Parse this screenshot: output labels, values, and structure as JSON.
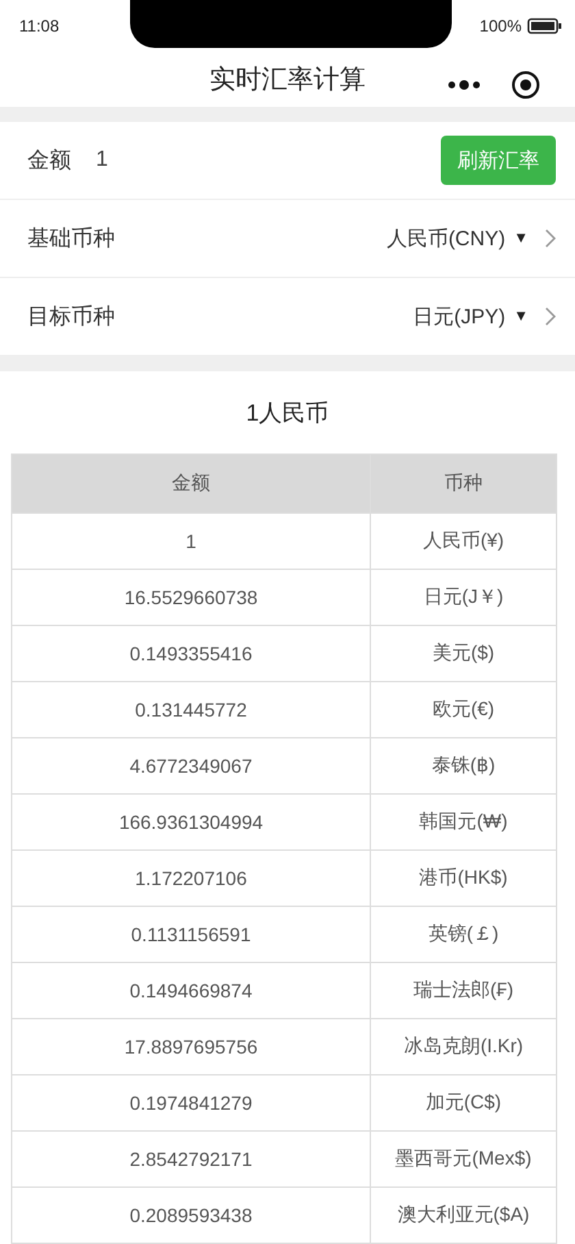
{
  "status_bar": {
    "time": "11:08",
    "battery_text": "100%"
  },
  "nav": {
    "title": "实时汇率计算"
  },
  "form": {
    "amount_label": "金额",
    "amount_value": "1",
    "refresh_button": "刷新汇率",
    "pickers": [
      {
        "label": "基础币种",
        "value": "人民币(CNY)",
        "caret": "▼"
      },
      {
        "label": "目标币种",
        "value": "日元(JPY)",
        "caret": "▼"
      }
    ]
  },
  "result": {
    "title": "1人民币",
    "columns": [
      "金额",
      "币种"
    ],
    "rows": [
      [
        "1",
        "人民币(¥)"
      ],
      [
        "16.5529660738",
        "日元(J￥)"
      ],
      [
        "0.1493355416",
        "美元($)"
      ],
      [
        "0.131445772",
        "欧元(€)"
      ],
      [
        "4.6772349067",
        "泰铢(฿)"
      ],
      [
        "166.9361304994",
        "韩国元(₩)"
      ],
      [
        "1.172207106",
        "港币(HK$)"
      ],
      [
        "0.1131156591",
        "英镑(￡)"
      ],
      [
        "0.1494669874",
        "瑞士法郎(₣)"
      ],
      [
        "17.8897695756",
        "冰岛克朗(I.Kr)"
      ],
      [
        "0.1974841279",
        "加元(C$)"
      ],
      [
        "2.8542792171",
        "墨西哥元(Mex$)"
      ],
      [
        "0.2089593438",
        "澳大利亚元($A)"
      ]
    ]
  }
}
